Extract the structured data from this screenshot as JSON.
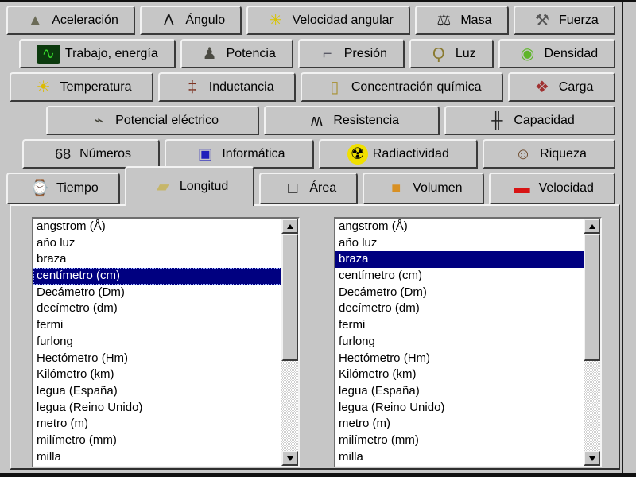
{
  "colors": {
    "window_bg": "#c6c6c6",
    "list_bg": "#ffffff",
    "selection_bg": "#000080",
    "selection_fg": "#ffffff",
    "tab_text": "#000000"
  },
  "tabs": {
    "selected": "Longitud",
    "rows": [
      {
        "items": [
          {
            "id": "aceleracion",
            "label": "Aceleración",
            "icon": "rocket-icon",
            "glyph": "▲",
            "color": "#6b6b57"
          },
          {
            "id": "angulo",
            "label": "Ángulo",
            "icon": "compass-angle-icon",
            "glyph": "Λ",
            "color": "#111111"
          },
          {
            "id": "velocidad-angular",
            "label": "Velocidad angular",
            "icon": "propeller-icon",
            "glyph": "✳",
            "color": "#d8c400"
          },
          {
            "id": "masa",
            "label": "Masa",
            "icon": "balance-scale-icon",
            "glyph": "⚖",
            "color": "#222222"
          },
          {
            "id": "fuerza",
            "label": "Fuerza",
            "icon": "hammer-icon",
            "glyph": "⚒",
            "color": "#555555"
          }
        ]
      },
      {
        "items": [
          {
            "id": "trabajo-energia",
            "label": "Trabajo, energía",
            "icon": "oscilloscope-icon",
            "glyph": "∿",
            "color": "#35d62a",
            "icon_bg": "#0c3a0e"
          },
          {
            "id": "potencia",
            "label": "Potencia",
            "icon": "strongman-icon",
            "glyph": "♟",
            "color": "#4a4a42"
          },
          {
            "id": "presion",
            "label": "Presión",
            "icon": "faucet-icon",
            "glyph": "⌐",
            "color": "#5a5a66"
          },
          {
            "id": "luz",
            "label": "Luz",
            "icon": "light-bulb-icon",
            "glyph": "Ϙ",
            "color": "#8a7a30"
          },
          {
            "id": "densidad",
            "label": "Densidad",
            "icon": "frog-icon",
            "glyph": "◉",
            "color": "#5fb52a"
          }
        ]
      },
      {
        "items": [
          {
            "id": "temperatura",
            "label": "Temperatura",
            "icon": "sun-icon",
            "glyph": "☀",
            "color": "#ddbb00"
          },
          {
            "id": "inductancia",
            "label": "Inductancia",
            "icon": "power-pole-icon",
            "glyph": "‡",
            "color": "#7a2e1c"
          },
          {
            "id": "concentracion-quimica",
            "label": "Concentración química",
            "icon": "graduated-cylinder-icon",
            "glyph": "▯",
            "color": "#a89030"
          },
          {
            "id": "carga",
            "label": "Carga",
            "icon": "charge-diamond-icon",
            "glyph": "❖",
            "color": "#a03030"
          }
        ]
      },
      {
        "items": [
          {
            "id": "potencial-electrico",
            "label": "Potencial eléctrico",
            "icon": "battery-plug-icon",
            "glyph": "⌁",
            "color": "#44443a"
          },
          {
            "id": "resistencia",
            "label": "Resistencia",
            "icon": "sine-wave-icon",
            "glyph": "ʍ",
            "color": "#111111"
          },
          {
            "id": "capacidad",
            "label": "Capacidad",
            "icon": "capacitor-icon",
            "glyph": "╫",
            "color": "#222222"
          }
        ]
      },
      {
        "items": [
          {
            "id": "numeros",
            "label": "Números",
            "icon": "digits-68-icon",
            "glyph": "68",
            "color": "#111111"
          },
          {
            "id": "informatica",
            "label": "Informática",
            "icon": "computer-monitor-icon",
            "glyph": "▣",
            "color": "#2222bb"
          },
          {
            "id": "radiactividad",
            "label": "Radiactividad",
            "icon": "radiation-icon",
            "glyph": "☢",
            "color": "#000000",
            "icon_bg": "#f0e000",
            "round": true
          },
          {
            "id": "riqueza",
            "label": "Riqueza",
            "icon": "rich-man-icon",
            "glyph": "☺",
            "color": "#6a4626"
          }
        ]
      },
      {
        "items": [
          {
            "id": "tiempo",
            "label": "Tiempo",
            "icon": "wristwatch-icon",
            "glyph": "⌚",
            "color": "#333322"
          },
          {
            "id": "longitud",
            "label": "Longitud",
            "icon": "ruler-icon",
            "glyph": "▰",
            "color": "#c6b669"
          },
          {
            "id": "area",
            "label": "Área",
            "icon": "square-outline-icon",
            "glyph": "□",
            "color": "#222222"
          },
          {
            "id": "volumen",
            "label": "Volumen",
            "icon": "box-icon",
            "glyph": "■",
            "color": "#d89024"
          },
          {
            "id": "velocidad",
            "label": "Velocidad",
            "icon": "car-icon",
            "glyph": "▬",
            "color": "#d81414"
          }
        ]
      }
    ]
  },
  "panel": {
    "lists": {
      "left": {
        "name": "left-unit-list",
        "selected_index": 3,
        "selected_value": "centímetro (cm)",
        "has_focus": true,
        "items": [
          "angstrom (Å)",
          "año luz",
          "braza",
          "centímetro (cm)",
          "Decámetro (Dm)",
          "decímetro (dm)",
          "fermi",
          "furlong",
          "Hectómetro (Hm)",
          "Kilómetro (km)",
          "legua (España)",
          "legua (Reino Unido)",
          "metro (m)",
          "milímetro (mm)",
          "milla"
        ]
      },
      "right": {
        "name": "right-unit-list",
        "selected_index": 2,
        "selected_value": "braza",
        "has_focus": false,
        "items": [
          "angstrom (Å)",
          "año luz",
          "braza",
          "centímetro (cm)",
          "Decámetro (Dm)",
          "decímetro (dm)",
          "fermi",
          "furlong",
          "Hectómetro (Hm)",
          "Kilómetro (km)",
          "legua (España)",
          "legua (Reino Unido)",
          "metro (m)",
          "milímetro (mm)",
          "milla"
        ]
      }
    }
  }
}
